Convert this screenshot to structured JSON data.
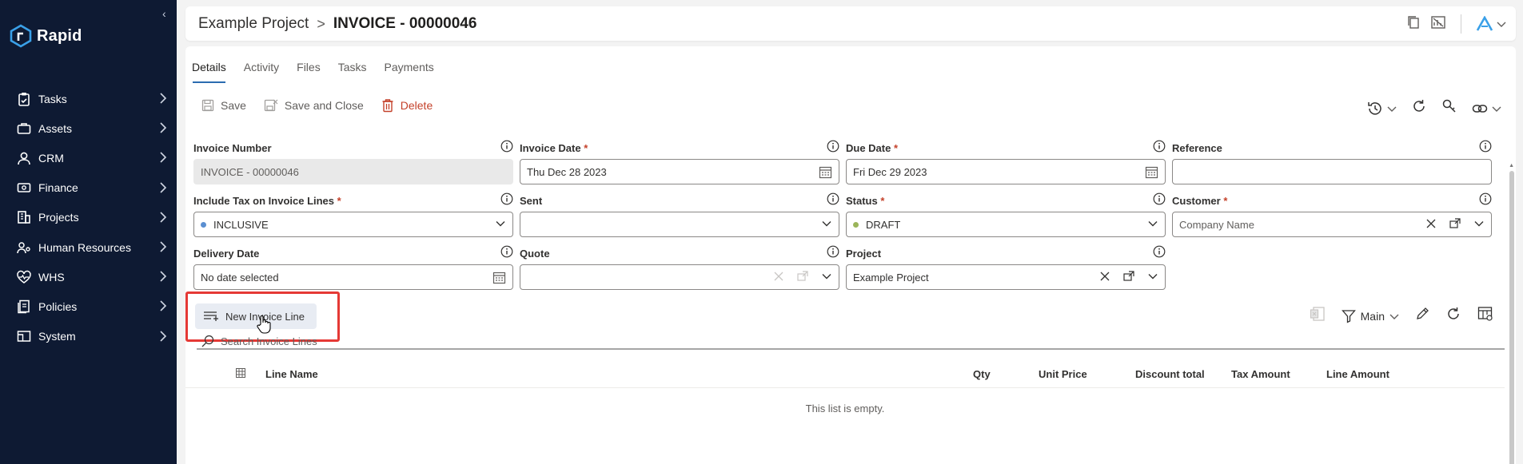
{
  "app": {
    "brand": "Rapid",
    "accent": "#2b6cb0",
    "sidebar_bg": "#0e1a33",
    "danger": "#c4412a"
  },
  "sidebar": {
    "items": [
      {
        "label": "Tasks",
        "icon": "clipboard-check-icon"
      },
      {
        "label": "Assets",
        "icon": "briefcase-icon"
      },
      {
        "label": "CRM",
        "icon": "person-icon"
      },
      {
        "label": "Finance",
        "icon": "banknote-icon"
      },
      {
        "label": "Projects",
        "icon": "building-icon"
      },
      {
        "label": "Human Resources",
        "icon": "people-network-icon"
      },
      {
        "label": "WHS",
        "icon": "heart-pulse-icon"
      },
      {
        "label": "Policies",
        "icon": "documents-icon"
      },
      {
        "label": "System",
        "icon": "system-panel-icon"
      }
    ]
  },
  "header": {
    "breadcrumb_project": "Example Project",
    "breadcrumb_separator": ">",
    "title": "INVOICE - 00000046"
  },
  "tabs": [
    {
      "label": "Details",
      "active": true
    },
    {
      "label": "Activity",
      "active": false
    },
    {
      "label": "Files",
      "active": false
    },
    {
      "label": "Tasks",
      "active": false
    },
    {
      "label": "Payments",
      "active": false
    }
  ],
  "toolbar": {
    "save_label": "Save",
    "save_close_label": "Save and Close",
    "delete_label": "Delete"
  },
  "form": {
    "invoice_number": {
      "label": "Invoice Number",
      "value": "INVOICE - 00000046"
    },
    "invoice_date": {
      "label": "Invoice Date",
      "required": "*",
      "value": "Thu Dec 28 2023"
    },
    "due_date": {
      "label": "Due Date",
      "required": "*",
      "value": "Fri Dec 29 2023"
    },
    "reference": {
      "label": "Reference",
      "value": ""
    },
    "include_tax": {
      "label": "Include Tax on Invoice Lines",
      "required": "*",
      "value": "INCLUSIVE",
      "dot_color": "#5b8fd1"
    },
    "sent": {
      "label": "Sent",
      "value": ""
    },
    "status": {
      "label": "Status",
      "required": "*",
      "value": "DRAFT",
      "dot_color": "#9bb55a"
    },
    "customer": {
      "label": "Customer",
      "required": "*",
      "placeholder": "Company Name"
    },
    "delivery_date": {
      "label": "Delivery Date",
      "placeholder": "No date selected"
    },
    "quote": {
      "label": "Quote",
      "value": ""
    },
    "project": {
      "label": "Project",
      "value": "Example Project"
    }
  },
  "lines": {
    "new_line_label": "New Invoice Line",
    "view_label": "Main",
    "search_placeholder": "Search Invoice Lines",
    "columns": [
      "Line Name",
      "Qty",
      "Unit Price",
      "Discount total",
      "Tax Amount",
      "Line Amount"
    ],
    "empty_text": "This list is empty."
  }
}
